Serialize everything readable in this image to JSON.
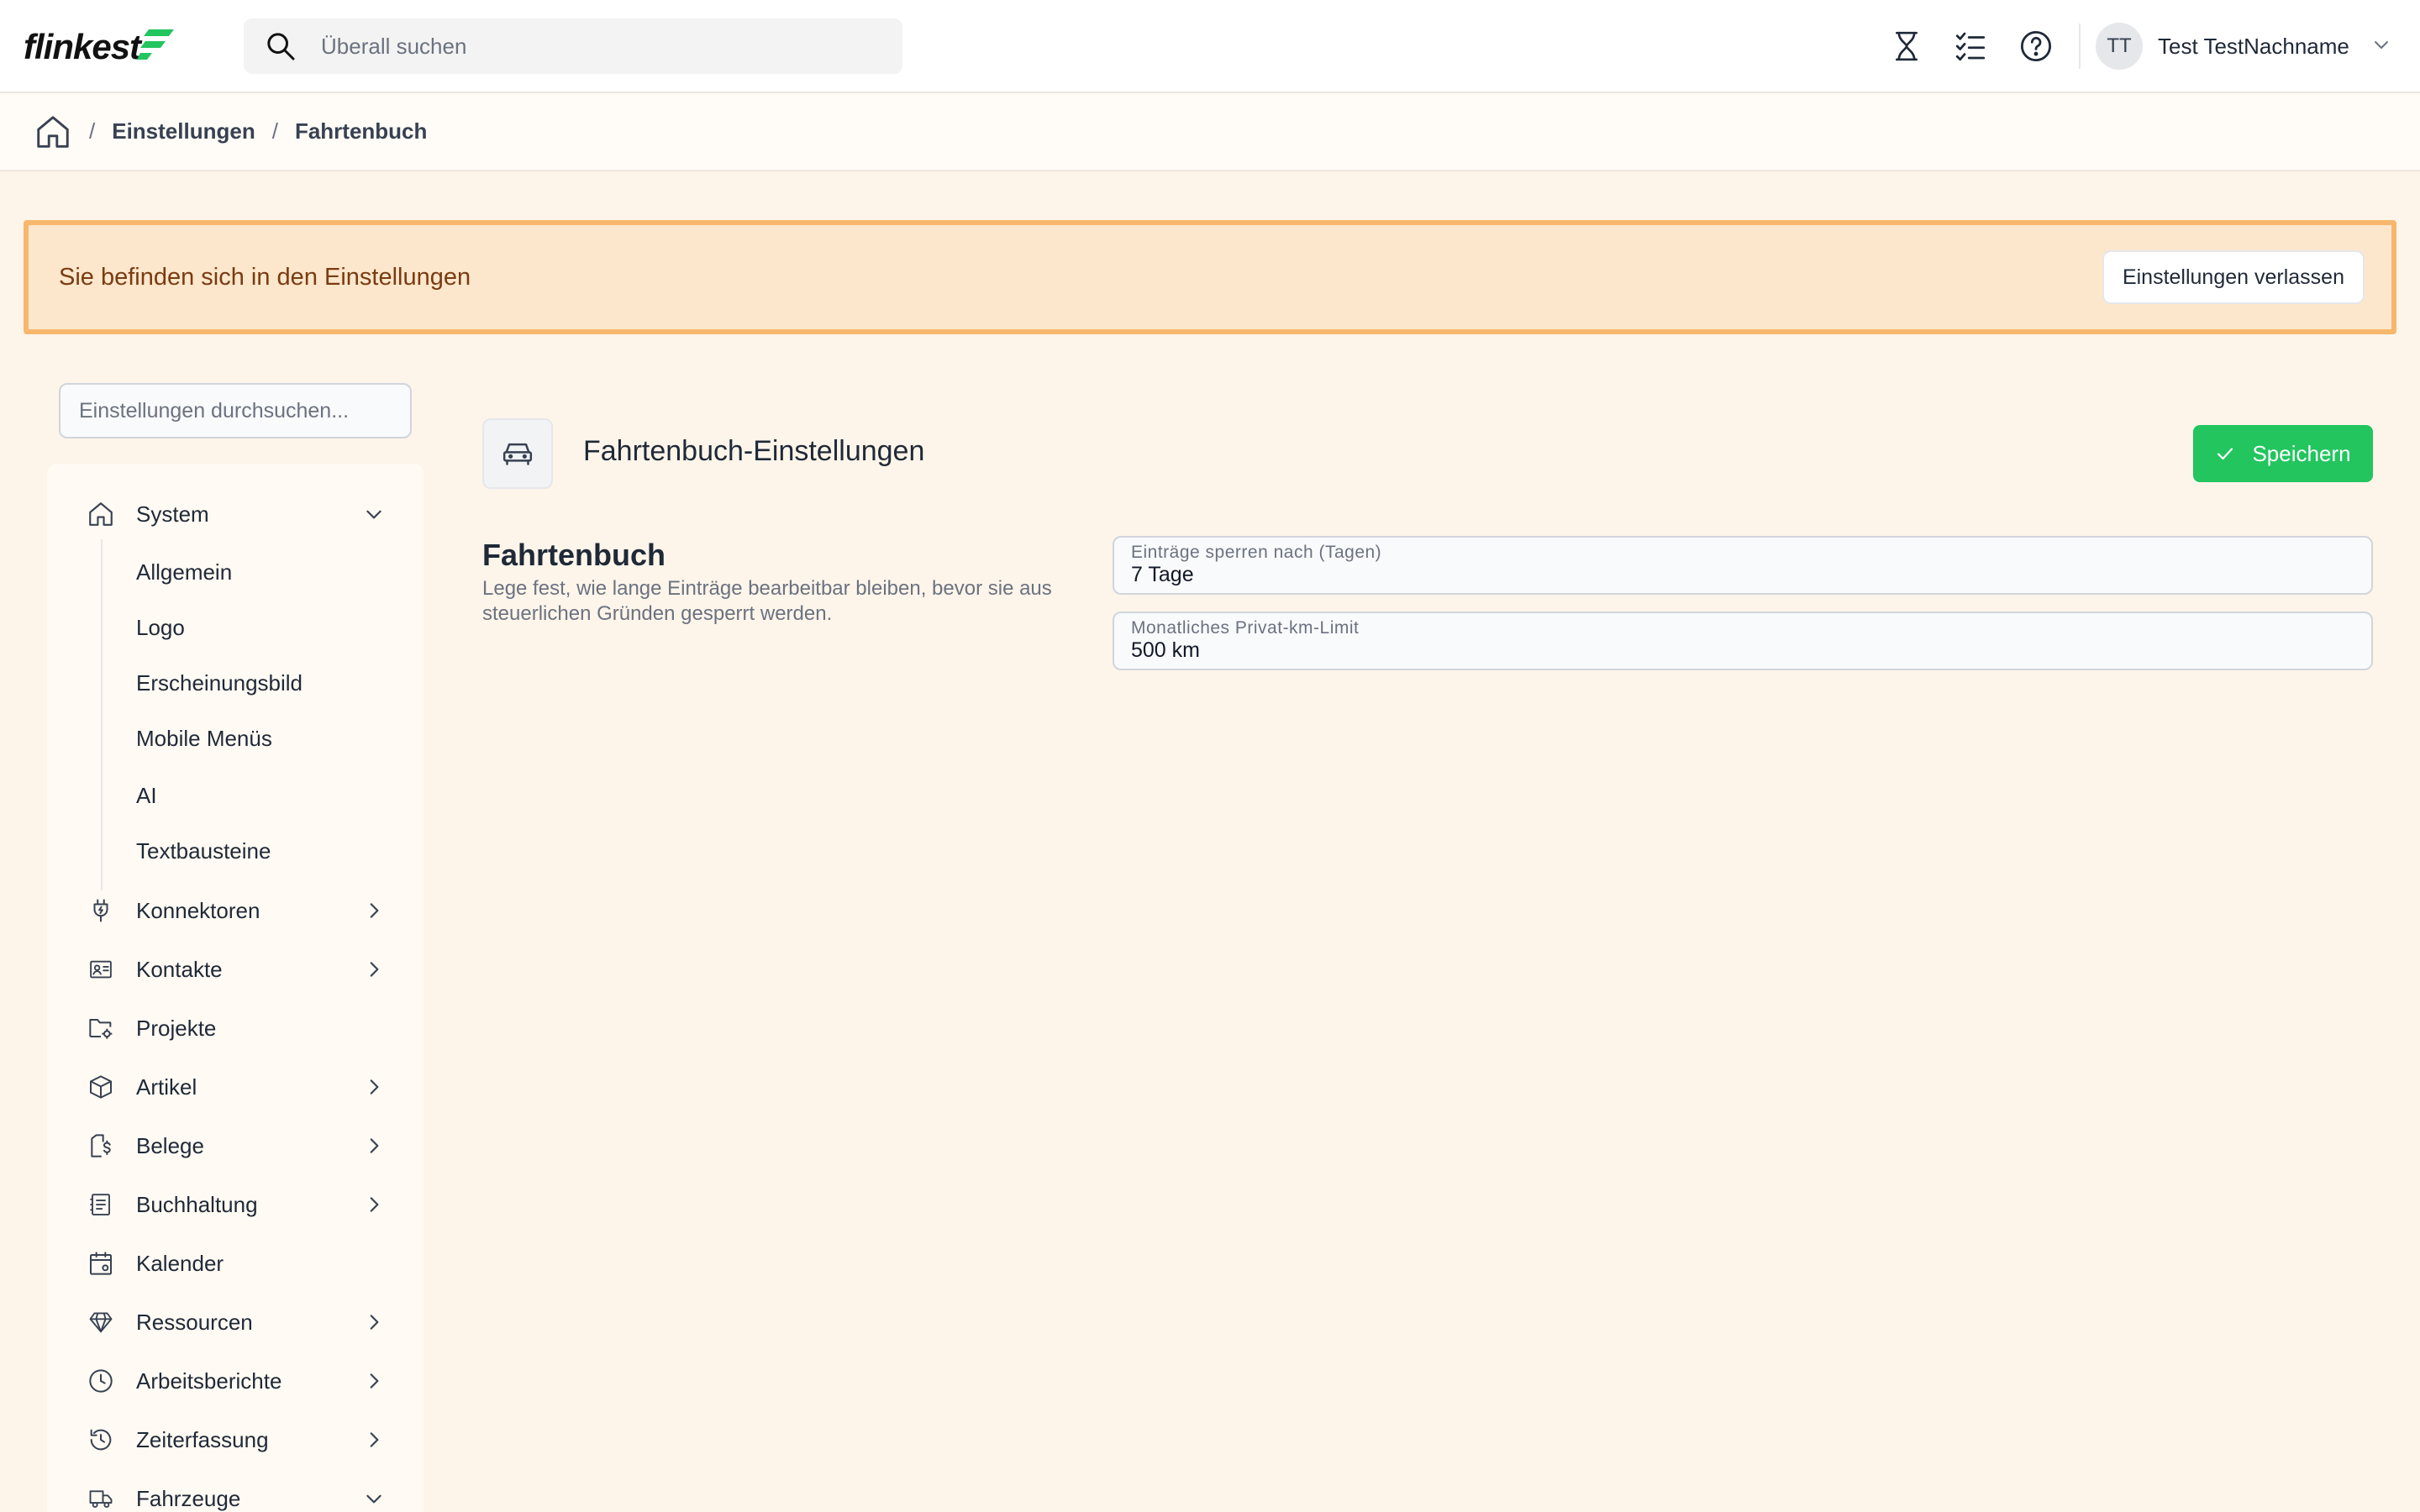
{
  "header": {
    "logo_text": "flinkest",
    "search_placeholder": "Überall suchen",
    "user_initials": "TT",
    "user_name": "Test TestNachname"
  },
  "breadcrumb": {
    "items": [
      "Einstellungen",
      "Fahrtenbuch"
    ]
  },
  "banner": {
    "text": "Sie befinden sich in den Einstellungen",
    "button_label": "Einstellungen verlassen"
  },
  "sidebar": {
    "search_placeholder": "Einstellungen durchsuchen...",
    "system": {
      "label": "System",
      "children": [
        "Allgemein",
        "Logo",
        "Erscheinungsbild",
        "Mobile Menüs",
        "AI",
        "Textbausteine"
      ]
    },
    "items": [
      {
        "label": "Konnektoren",
        "icon": "plug-icon",
        "has_children": true
      },
      {
        "label": "Kontakte",
        "icon": "contact-card-icon",
        "has_children": true
      },
      {
        "label": "Projekte",
        "icon": "folder-gear-icon",
        "has_children": false
      },
      {
        "label": "Artikel",
        "icon": "box-icon",
        "has_children": true
      },
      {
        "label": "Belege",
        "icon": "receipt-icon",
        "has_children": true
      },
      {
        "label": "Buchhaltung",
        "icon": "ledger-icon",
        "has_children": true
      },
      {
        "label": "Kalender",
        "icon": "calendar-icon",
        "has_children": false
      },
      {
        "label": "Ressourcen",
        "icon": "gem-icon",
        "has_children": true
      },
      {
        "label": "Arbeitsberichte",
        "icon": "clock-icon",
        "has_children": true
      },
      {
        "label": "Zeiterfassung",
        "icon": "history-icon",
        "has_children": true
      },
      {
        "label": "Fahrzeuge",
        "icon": "truck-icon",
        "has_children": true,
        "expanded": true
      }
    ]
  },
  "main": {
    "title": "Fahrtenbuch-Einstellungen",
    "save_label": "Speichern",
    "section_title": "Fahrtenbuch",
    "section_description": "Lege fest, wie lange Einträge bearbeitbar bleiben, bevor sie aus steuerlichen Gründen gesperrt werden.",
    "fields": [
      {
        "label": "Einträge sperren nach (Tagen)",
        "value": "7 Tage"
      },
      {
        "label": "Monatliches Privat-km-Limit",
        "value": "500 km"
      }
    ]
  },
  "colors": {
    "accent_green": "#22c55e",
    "banner_bg": "#fde7cc",
    "banner_border": "#f7b76c",
    "page_bg": "#fdf5ea"
  }
}
